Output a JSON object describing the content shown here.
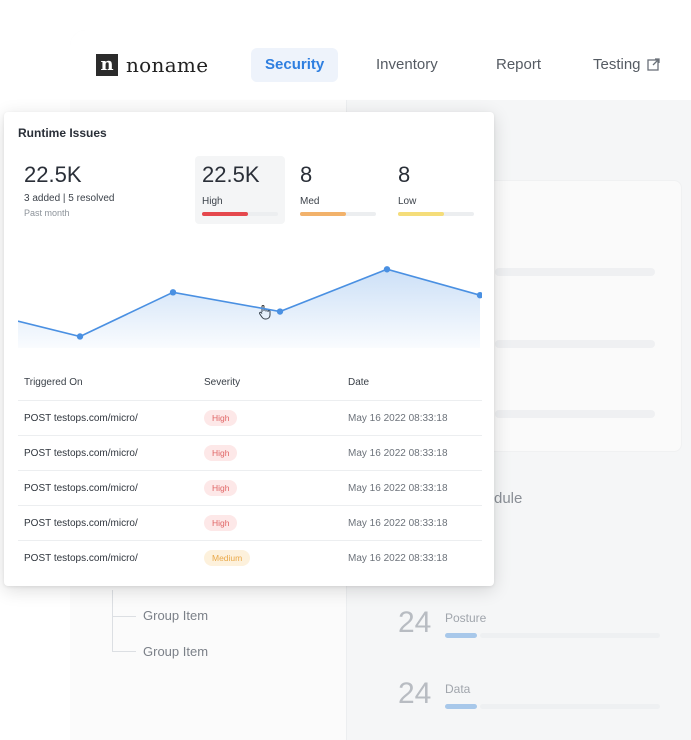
{
  "nav": {
    "logo_mark": "n",
    "logo_text": "noname",
    "tabs": [
      {
        "label": "Security",
        "active": true
      },
      {
        "label": "Inventory",
        "active": false
      },
      {
        "label": "Report",
        "active": false
      },
      {
        "label": "Testing",
        "active": false,
        "icon": "external-link-icon"
      }
    ],
    "accent_color": "#2f7fe0"
  },
  "background": {
    "group_items": [
      "Group Item",
      "Group Item"
    ],
    "partial_heading": "dule",
    "stats": [
      {
        "value": "24",
        "label": "Posture"
      },
      {
        "value": "24",
        "label": "Data"
      }
    ]
  },
  "card": {
    "title": "Runtime Issues",
    "total": {
      "value": "22.5K",
      "summary": "3 added  |  5 resolved",
      "period": "Past month"
    },
    "severities": [
      {
        "value": "22.5K",
        "label": "High",
        "color": "#e5484d",
        "fill": 0.6
      },
      {
        "value": "8",
        "label": "Med",
        "color": "#f2b26b",
        "fill": 0.6
      },
      {
        "value": "8",
        "label": "Low",
        "color": "#f5dd7a",
        "fill": 0.6
      }
    ],
    "trend": {
      "points": [
        0.72,
        0.88,
        0.42,
        0.62,
        0.18,
        0.45
      ],
      "color": "#4a90e2"
    },
    "table": {
      "headers": [
        "Triggered On",
        "Severity",
        "Date"
      ],
      "rows": [
        {
          "endpoint": "POST testops.com/micro/",
          "severity": "High",
          "level": "high",
          "date": "May 16 2022 08:33:18"
        },
        {
          "endpoint": "POST testops.com/micro/",
          "severity": "High",
          "level": "high",
          "date": "May 16 2022 08:33:18"
        },
        {
          "endpoint": "POST testops.com/micro/",
          "severity": "High",
          "level": "high",
          "date": "May 16 2022 08:33:18"
        },
        {
          "endpoint": "POST testops.com/micro/",
          "severity": "High",
          "level": "high",
          "date": "May 16 2022 08:33:18"
        },
        {
          "endpoint": "POST testops.com/micro/",
          "severity": "Medium",
          "level": "medium",
          "date": "May 16 2022 08:33:18"
        }
      ]
    }
  }
}
